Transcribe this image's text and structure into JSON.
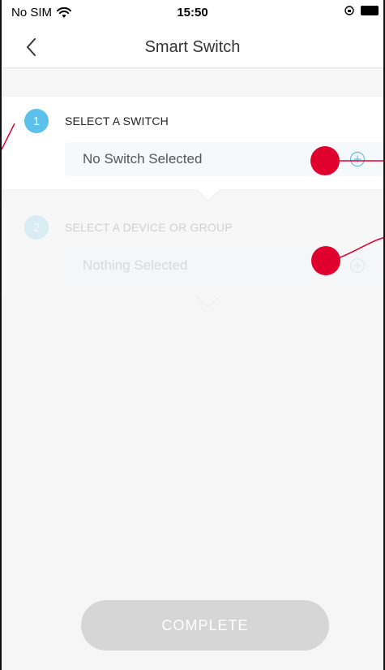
{
  "status_bar": {
    "carrier": "No SIM",
    "time": "15:50"
  },
  "nav": {
    "title": "Smart Switch"
  },
  "steps": [
    {
      "number": "1",
      "title": "SELECT A SWITCH",
      "value": "No Switch Selected",
      "enabled": true
    },
    {
      "number": "2",
      "title": "SELECT A DEVICE OR GROUP",
      "value": "Nothing Selected",
      "enabled": false
    }
  ],
  "complete_button": {
    "label": "COMPLETE",
    "enabled": false
  },
  "colors": {
    "accent": "#5bc0ea",
    "annotation": "#e0002d",
    "disabled_button": "#d6d6d6"
  },
  "icons": [
    "wifi-icon",
    "back-chevron-icon",
    "plus-circle-icon",
    "orientation-lock-icon",
    "battery-icon"
  ]
}
